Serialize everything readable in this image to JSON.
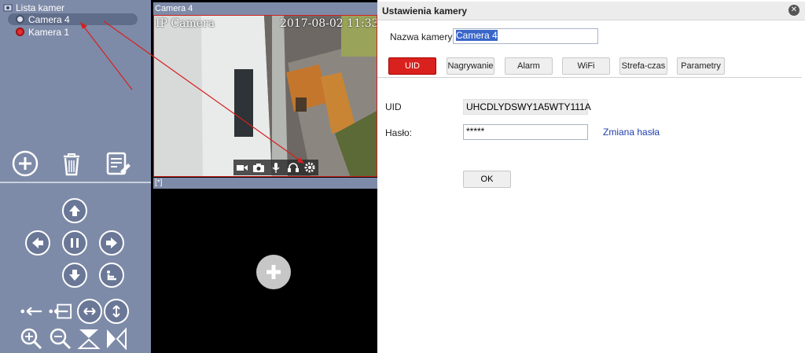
{
  "camera_list": {
    "root_label": "Lista kamer",
    "items": [
      {
        "label": "Camera 4",
        "selected": true
      },
      {
        "label": "Kamera 1",
        "selected": false
      }
    ]
  },
  "video": {
    "panel1_title": "Camera 4",
    "osd_name": "IP Camera",
    "osd_time": "2017-08-02 11:33",
    "panel2_title": "[*]"
  },
  "dialog": {
    "title": "Ustawienia kamery",
    "name_label": "Nazwa kamery:",
    "name_value": "Camera 4",
    "tabs": [
      {
        "label": "UID",
        "active": true
      },
      {
        "label": "Nagrywanie",
        "active": false
      },
      {
        "label": "Alarm",
        "active": false
      },
      {
        "label": "WiFi",
        "active": false
      },
      {
        "label": "Strefa-czas",
        "active": false
      },
      {
        "label": "Parametry",
        "active": false
      }
    ],
    "uid_label": "UID",
    "uid_value": "UHCDLYDSWY1A5WTY111A",
    "password_label": "Hasło:",
    "password_value": "*****",
    "change_password_link": "Zmiana hasła",
    "ok_label": "OK"
  },
  "colors": {
    "panel_bg": "#7e8ba8",
    "active_tab": "#d9211d",
    "link": "#1f3faf",
    "annotation_arrow": "#d62020"
  }
}
